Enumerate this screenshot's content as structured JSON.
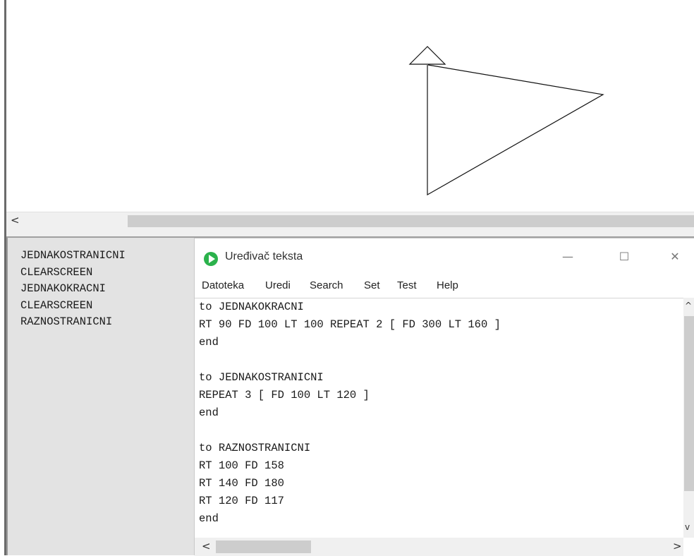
{
  "canvas": {
    "turtle_icon": "triangle-turtle-icon",
    "scrollbar_left_arrow": "<"
  },
  "history": {
    "items": [
      "JEDNAKOSTRANICNI",
      "CLEARSCREEN",
      "JEDNAKOKRACNI",
      "CLEARSCREEN",
      "RAZNOSTRANICNI"
    ]
  },
  "editor": {
    "title": "Uređivač teksta",
    "app_icon": "play-icon",
    "window_controls": {
      "minimize": "—",
      "maximize": "☐",
      "close": "✕"
    },
    "menu": [
      "Datoteka",
      "Uredi",
      "Search",
      "Set",
      "Test",
      "Help"
    ],
    "code_lines": [
      "to JEDNAKOKRACNI",
      "RT 90 FD 100 LT 100 REPEAT 2 [ FD 300 LT 160 ]",
      "end",
      "",
      "to JEDNAKOSTRANICNI",
      "REPEAT 3 [ FD 100 LT 120 ]",
      "end",
      "",
      "to RAZNOSTRANICNI",
      "RT 100 FD 158",
      "RT 140 FD 180",
      "RT 120 FD 117",
      "end"
    ],
    "scroll": {
      "left": "<",
      "right": ">",
      "up": "^",
      "down": "v"
    }
  },
  "colors": {
    "accent": "#2bb24c",
    "history_bg": "#e3e3e3",
    "scroll_thumb": "#cdcdcd"
  }
}
